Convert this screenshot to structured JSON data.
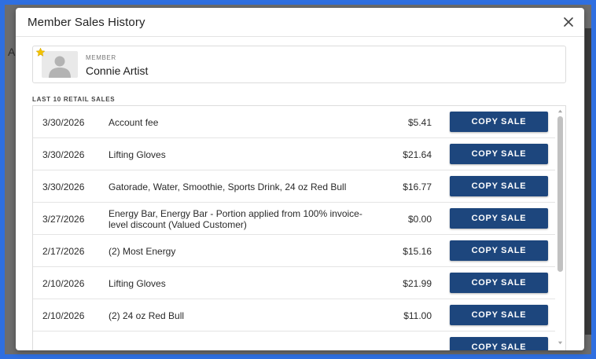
{
  "modal": {
    "title": "Member Sales History"
  },
  "member": {
    "label": "MEMBER",
    "name": "Connie Artist"
  },
  "sales": {
    "section_label": "LAST 10 RETAIL SALES",
    "copy_label": "COPY SALE",
    "rows": [
      {
        "date": "3/30/2026",
        "description": "Account fee",
        "amount": "$5.41"
      },
      {
        "date": "3/30/2026",
        "description": "Lifting Gloves",
        "amount": "$21.64"
      },
      {
        "date": "3/30/2026",
        "description": "Gatorade, Water, Smoothie, Sports Drink, 24 oz Red Bull",
        "amount": "$16.77"
      },
      {
        "date": "3/27/2026",
        "description": "Energy Bar, Energy Bar - Portion applied from 100% invoice-level discount (Valued Customer)",
        "amount": "$0.00"
      },
      {
        "date": "2/17/2026",
        "description": "(2) Most Energy",
        "amount": "$15.16"
      },
      {
        "date": "2/10/2026",
        "description": "Lifting Gloves",
        "amount": "$21.99"
      },
      {
        "date": "2/10/2026",
        "description": "(2) 24 oz Red Bull",
        "amount": "$11.00"
      },
      {
        "date": "",
        "description": "",
        "amount": ""
      }
    ]
  },
  "colors": {
    "button": "#1d467d",
    "star": "#f2c200",
    "frame": "#2f6fe0"
  }
}
